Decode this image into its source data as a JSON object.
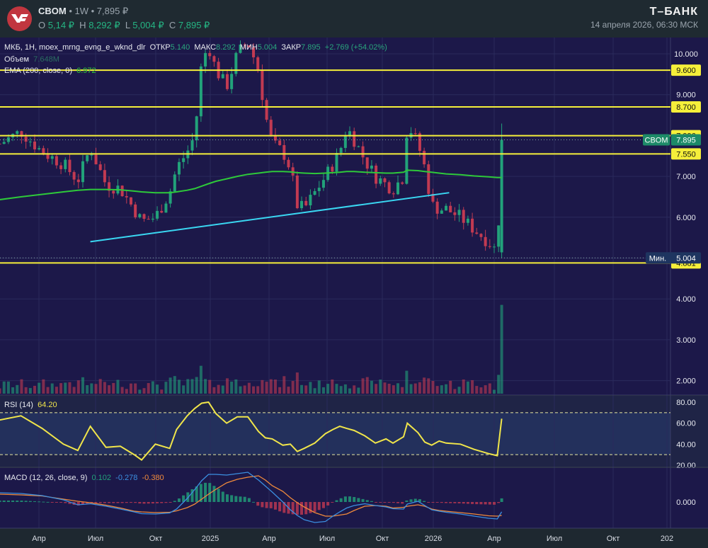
{
  "header": {
    "ticker": "CBOM",
    "interval": "1W",
    "price": "7,895 ₽",
    "ohlc": [
      {
        "k": "O",
        "v": "5,14 ₽"
      },
      {
        "k": "H",
        "v": "8,292 ₽"
      },
      {
        "k": "L",
        "v": "5,004 ₽"
      },
      {
        "k": "C",
        "v": "7,895 ₽"
      }
    ],
    "brand": "Т–БАНК",
    "datetime": "14 апреля 2026, 06:30 МСК"
  },
  "legend": {
    "symbol": "МКБ, 1Н, moex_mrng_evng_e_wknd_dlr",
    "open_k": "ОТКР",
    "open": "5.140",
    "high_k": "МАКС",
    "high": "8.292",
    "low_k": "МИН",
    "low": "5.004",
    "close_k": "ЗАКР",
    "close": "7.895",
    "change": "+2.769 (+54.02%)",
    "volume_k": "Объем",
    "volume": "7.648M",
    "ema_k": "EMA (200, close, 0)",
    "ema": "6.972",
    "rsi_k": "RSI (14)",
    "rsi": "64.20",
    "macd_k": "MACD (12, 26, close, 9)",
    "macd_hist": "0.102",
    "macd": "-0.278",
    "macd_signal": "-0.380"
  },
  "colors": {
    "up": "#22a27a",
    "down": "#c23a52",
    "ema": "#2ec93a",
    "trendline": "#3ad7f2",
    "level": "#f5ef3a",
    "rsi": "#f0e54a",
    "macd": "#3b8fe0",
    "signal": "#f08a3c"
  },
  "chart_data": {
    "type": "candlestick",
    "price_axis": {
      "ticks": [
        "10.000",
        "9.000",
        "7.000",
        "6.000",
        "4.000",
        "3.000",
        "2.000"
      ],
      "range": [
        1.7,
        10.4
      ]
    },
    "time_axis": {
      "ticks": [
        "Апр",
        "Июл",
        "Окт",
        "2025",
        "Апр",
        "Июл",
        "Окт",
        "2026",
        "Апр",
        "Июл",
        "Окт",
        "202"
      ]
    },
    "levels": [
      {
        "value": 9.6,
        "label": "9.600"
      },
      {
        "value": 8.7,
        "label": "8.700"
      },
      {
        "value": 7.996,
        "label": "7.996"
      },
      {
        "value": 7.55,
        "label": "7.550"
      },
      {
        "value": 4.881,
        "label": "4.881"
      }
    ],
    "last_price": {
      "label": "CBOM",
      "value": 7.895,
      "text": "7.895"
    },
    "min_price": {
      "label": "Мин.",
      "value": 5.004,
      "text": "5.004"
    },
    "trendline": [
      {
        "date": "2024-06-24",
        "value": 5.4
      },
      {
        "date": "2026-01-19",
        "value": 6.6
      }
    ],
    "dates": [
      "2024-01-31",
      "2024-03-05",
      "2024-04-08",
      "2024-05-12",
      "2024-06-04",
      "2024-06-24",
      "2024-07-19",
      "2024-08-11",
      "2024-09-02",
      "2024-09-14",
      "2024-10-06",
      "2024-10-29",
      "2024-11-09",
      "2024-11-26",
      "2024-12-08",
      "2024-12-19",
      "2024-12-30",
      "2025-01-11",
      "2025-01-28",
      "2025-02-14",
      "2025-03-03",
      "2025-03-20",
      "2025-03-31",
      "2025-04-11",
      "2025-04-28",
      "2025-05-10",
      "2025-05-21",
      "2025-06-01",
      "2025-06-18",
      "2025-07-05",
      "2025-07-17",
      "2025-07-28",
      "2025-08-08",
      "2025-08-20",
      "2025-09-06",
      "2025-09-23",
      "2025-10-10",
      "2025-10-21",
      "2025-11-07",
      "2025-11-13",
      "2025-11-30",
      "2025-12-11",
      "2025-12-22",
      "2026-01-03",
      "2026-01-14",
      "2026-02-06",
      "2026-02-28",
      "2026-03-23",
      "2026-04-06",
      "2026-04-13"
    ],
    "close": [
      7.8,
      8.1,
      7.6,
      7.3,
      6.9,
      7.7,
      6.8,
      6.7,
      6.2,
      5.9,
      6.0,
      6.6,
      7.2,
      7.6,
      8.0,
      9.8,
      10.2,
      9.6,
      9.2,
      10.0,
      10.3,
      9.6,
      8.5,
      7.8,
      7.6,
      7.2,
      6.3,
      6.2,
      6.6,
      7.0,
      7.3,
      7.6,
      8.2,
      7.9,
      7.4,
      7.0,
      6.8,
      6.7,
      7.0,
      8.3,
      7.8,
      7.2,
      6.3,
      6.2,
      6.2,
      6.0,
      5.7,
      5.4,
      5.14,
      7.895
    ],
    "ema": [
      6.43,
      6.5,
      6.56,
      6.62,
      6.66,
      6.68,
      6.68,
      6.67,
      6.64,
      6.62,
      6.6,
      6.6,
      6.62,
      6.66,
      6.7,
      6.76,
      6.82,
      6.88,
      6.94,
      7.0,
      7.05,
      7.08,
      7.1,
      7.12,
      7.12,
      7.11,
      7.09,
      7.08,
      7.07,
      7.08,
      7.09,
      7.1,
      7.12,
      7.12,
      7.1,
      7.09,
      7.08,
      7.08,
      7.1,
      7.15,
      7.14,
      7.12,
      7.1,
      7.08,
      7.06,
      7.04,
      7.01,
      6.99,
      6.97,
      6.972
    ],
    "volume_last": 7.648,
    "rsi": {
      "levels": [
        70,
        30
      ],
      "ticks": [
        "80.00",
        "60.00",
        "40.00",
        "20.00"
      ],
      "values": [
        63,
        67,
        55,
        40,
        34,
        57,
        37,
        38,
        30,
        25,
        40,
        36,
        54,
        67,
        74,
        79,
        80,
        69,
        60,
        66,
        66,
        52,
        46,
        45,
        39,
        40,
        33,
        36,
        41,
        50,
        54,
        57,
        55,
        53,
        48,
        41,
        45,
        41,
        47,
        60,
        51,
        42,
        39,
        43,
        41,
        40,
        35,
        31,
        29,
        64.2
      ]
    },
    "macd": {
      "ticks": [
        "0.000"
      ],
      "macd": [
        0.26,
        0.24,
        0.18,
        0.06,
        -0.08,
        -0.05,
        -0.12,
        -0.2,
        -0.28,
        -0.33,
        -0.34,
        -0.31,
        -0.2,
        0.1,
        0.35,
        0.6,
        0.78,
        0.78,
        0.76,
        0.8,
        0.84,
        0.62,
        0.45,
        0.28,
        0.0,
        -0.22,
        -0.38,
        -0.5,
        -0.58,
        -0.55,
        -0.4,
        -0.28,
        -0.17,
        -0.1,
        -0.05,
        -0.1,
        -0.14,
        -0.19,
        -0.2,
        -0.06,
        0.02,
        -0.1,
        -0.22,
        -0.26,
        -0.29,
        -0.34,
        -0.4,
        -0.46,
        -0.48,
        -0.278
      ],
      "signal": [
        0.22,
        0.2,
        0.17,
        0.08,
        0.02,
        -0.02,
        -0.09,
        -0.17,
        -0.26,
        -0.28,
        -0.3,
        -0.29,
        -0.25,
        -0.16,
        -0.06,
        0.08,
        0.22,
        0.36,
        0.54,
        0.64,
        0.7,
        0.74,
        0.62,
        0.46,
        0.3,
        0.12,
        -0.02,
        -0.14,
        -0.3,
        -0.4,
        -0.4,
        -0.37,
        -0.34,
        -0.24,
        -0.12,
        -0.1,
        -0.12,
        -0.17,
        -0.15,
        -0.12,
        -0.08,
        -0.12,
        -0.2,
        -0.24,
        -0.26,
        -0.3,
        -0.34,
        -0.39,
        -0.4,
        -0.38
      ]
    }
  }
}
